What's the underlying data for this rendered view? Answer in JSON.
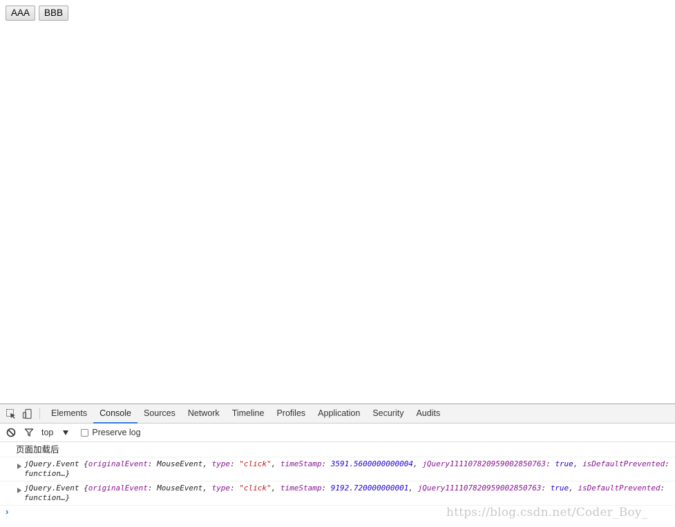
{
  "page": {
    "buttons": [
      {
        "label": "AAA"
      },
      {
        "label": "BBB"
      }
    ]
  },
  "devtools": {
    "icons": {
      "inspect": "inspect-element-icon",
      "device": "device-toggle-icon",
      "clear": "clear-console-icon",
      "filter": "filter-icon"
    },
    "tabs": [
      {
        "label": "Elements",
        "active": false
      },
      {
        "label": "Console",
        "active": true
      },
      {
        "label": "Sources",
        "active": false
      },
      {
        "label": "Network",
        "active": false
      },
      {
        "label": "Timeline",
        "active": false
      },
      {
        "label": "Profiles",
        "active": false
      },
      {
        "label": "Application",
        "active": false
      },
      {
        "label": "Security",
        "active": false
      },
      {
        "label": "Audits",
        "active": false
      }
    ],
    "toolbar": {
      "context": "top",
      "preserve_log_label": "Preserve log",
      "preserve_log_checked": false
    },
    "console": {
      "messages": [
        {
          "type": "text",
          "text": "页面加载后"
        },
        {
          "type": "object",
          "class_name": "jQuery.Event",
          "props": [
            {
              "key": "originalEvent",
              "value": "MouseEvent",
              "kind": "plain"
            },
            {
              "key": "type",
              "value": "\"click\"",
              "kind": "string"
            },
            {
              "key": "timeStamp",
              "value": "3591.5600000000004",
              "kind": "number"
            },
            {
              "key": "jQuery1111078209590028507​63",
              "value": "true",
              "kind": "bool"
            },
            {
              "key": "isDefaultPrevented",
              "value": "function…}",
              "kind": "plain"
            }
          ]
        },
        {
          "type": "object",
          "class_name": "jQuery.Event",
          "props": [
            {
              "key": "originalEvent",
              "value": "MouseEvent",
              "kind": "plain"
            },
            {
              "key": "type",
              "value": "\"click\"",
              "kind": "string"
            },
            {
              "key": "timeStamp",
              "value": "9192.720000000001",
              "kind": "number"
            },
            {
              "key": "jQuery111107820959002850763",
              "value": "true",
              "kind": "bool"
            },
            {
              "key": "isDefaultPrevented",
              "value": "function…}",
              "kind": "plain"
            }
          ]
        }
      ],
      "prompt_symbol": "›"
    }
  },
  "watermark": "https://blog.csdn.net/Coder_Boy_"
}
